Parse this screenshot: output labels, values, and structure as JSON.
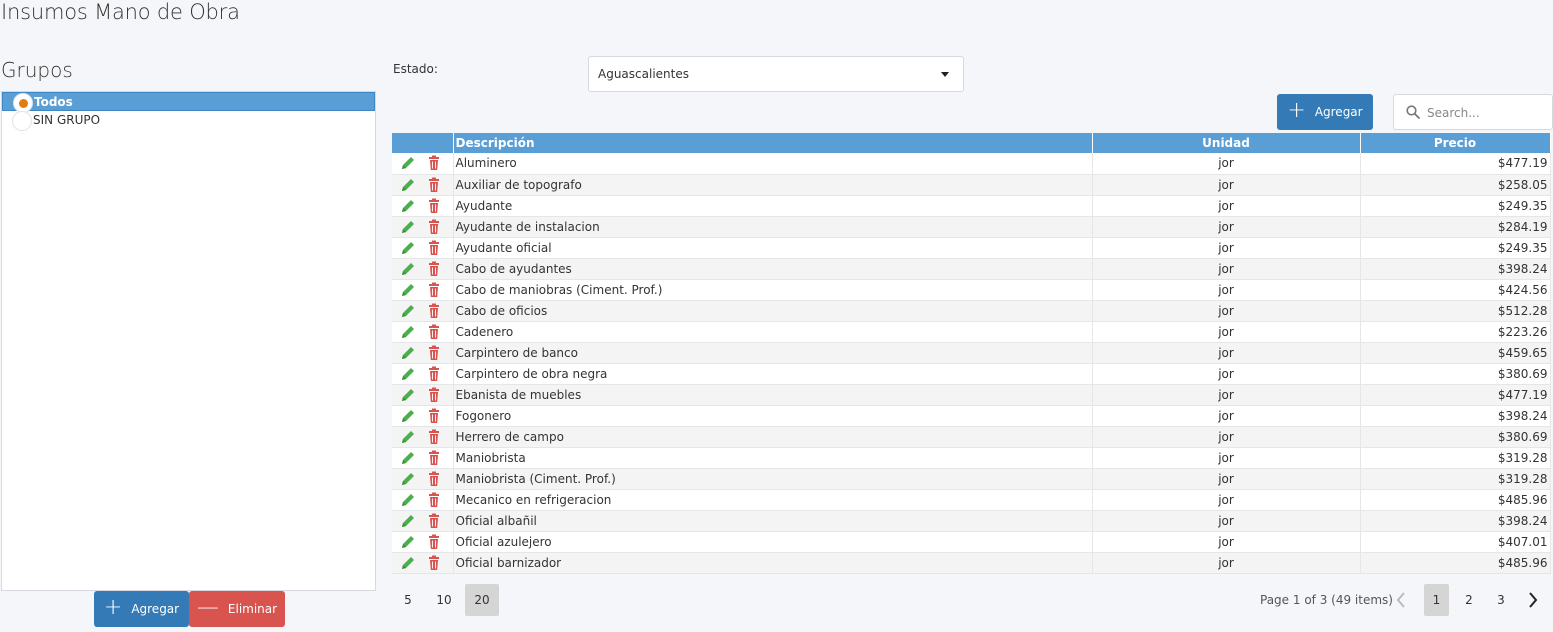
{
  "page": {
    "title": "Insumos Mano de Obra"
  },
  "groups": {
    "title": "Grupos",
    "items": [
      {
        "label": "Todos",
        "selected": true
      },
      {
        "label": "SIN GRUPO",
        "selected": false
      }
    ],
    "add_label": "Agregar",
    "delete_label": "Eliminar"
  },
  "filter": {
    "estado_label": "Estado:",
    "estado_value": "Aguascalientes"
  },
  "toolbar": {
    "add_label": "Agregar",
    "search_placeholder": "Search..."
  },
  "table": {
    "columns": [
      "",
      "Descripción",
      "Unidad",
      "Precio"
    ],
    "rows": [
      {
        "descripcion": "Aluminero",
        "unidad": "jor",
        "precio": "$477.19"
      },
      {
        "descripcion": "Auxiliar de topografo",
        "unidad": "jor",
        "precio": "$258.05"
      },
      {
        "descripcion": "Ayudante",
        "unidad": "jor",
        "precio": "$249.35"
      },
      {
        "descripcion": "Ayudante de instalacion",
        "unidad": "jor",
        "precio": "$284.19"
      },
      {
        "descripcion": "Ayudante oficial",
        "unidad": "jor",
        "precio": "$249.35"
      },
      {
        "descripcion": "Cabo de ayudantes",
        "unidad": "jor",
        "precio": "$398.24"
      },
      {
        "descripcion": "Cabo de maniobras (Ciment. Prof.)",
        "unidad": "jor",
        "precio": "$424.56"
      },
      {
        "descripcion": "Cabo de oficios",
        "unidad": "jor",
        "precio": "$512.28"
      },
      {
        "descripcion": "Cadenero",
        "unidad": "jor",
        "precio": "$223.26"
      },
      {
        "descripcion": "Carpintero de banco",
        "unidad": "jor",
        "precio": "$459.65"
      },
      {
        "descripcion": "Carpintero de obra negra",
        "unidad": "jor",
        "precio": "$380.69"
      },
      {
        "descripcion": "Ebanista de muebles",
        "unidad": "jor",
        "precio": "$477.19"
      },
      {
        "descripcion": "Fogonero",
        "unidad": "jor",
        "precio": "$398.24"
      },
      {
        "descripcion": "Herrero de campo",
        "unidad": "jor",
        "precio": "$380.69"
      },
      {
        "descripcion": "Maniobrista",
        "unidad": "jor",
        "precio": "$319.28"
      },
      {
        "descripcion": "Maniobrista (Ciment. Prof.)",
        "unidad": "jor",
        "precio": "$319.28"
      },
      {
        "descripcion": "Mecanico en refrigeracion",
        "unidad": "jor",
        "precio": "$485.96"
      },
      {
        "descripcion": "Oficial albañil",
        "unidad": "jor",
        "precio": "$398.24"
      },
      {
        "descripcion": "Oficial azulejero",
        "unidad": "jor",
        "precio": "$407.01"
      },
      {
        "descripcion": "Oficial barnizador",
        "unidad": "jor",
        "precio": "$485.96"
      }
    ]
  },
  "pager": {
    "sizes": [
      "5",
      "10",
      "20"
    ],
    "active_size": "20",
    "info": "Page 1 of 3 (49 items)",
    "pages": [
      "1",
      "2",
      "3"
    ],
    "active_page": "1"
  },
  "colors": {
    "header_blue": "#5a9ed6",
    "button_blue": "#337ab7",
    "button_red": "#d9534f",
    "edit_green": "#4cae4c",
    "delete_red": "#d9534f",
    "radio_orange": "#e07d10"
  },
  "icons": {
    "add": "plus-icon",
    "remove": "minus-icon",
    "edit": "pencil-icon",
    "delete": "trash-icon",
    "search": "search-icon",
    "dropdown": "caret-down-icon",
    "prev": "chevron-left-icon",
    "next": "chevron-right-icon"
  }
}
